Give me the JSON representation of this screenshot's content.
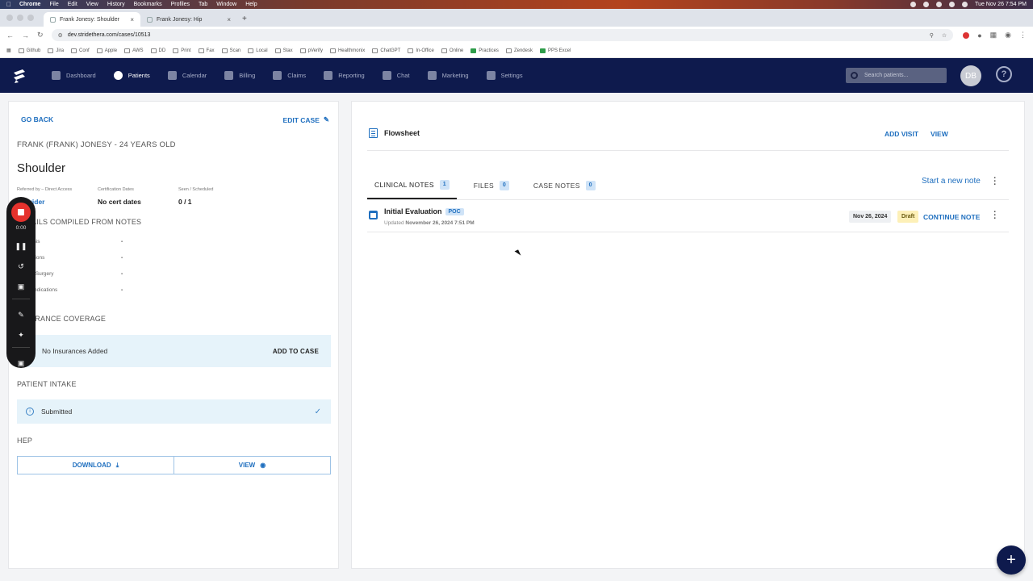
{
  "mac_menubar": {
    "app": "Chrome",
    "menus": [
      "File",
      "Edit",
      "View",
      "History",
      "Bookmarks",
      "Profiles",
      "Tab",
      "Window",
      "Help"
    ],
    "clock": "Tue Nov 26  7:54 PM"
  },
  "browser": {
    "tabs": [
      {
        "title": "Frank Jonesy: Shoulder",
        "active": true
      },
      {
        "title": "Frank Jonesy: Hip",
        "active": false
      }
    ],
    "url": "dev.stridethera.com/cases/10513",
    "bookmarks": [
      "Github",
      "Jira",
      "Conf",
      "Apple",
      "AWS",
      "DD",
      "Print",
      "Fax",
      "Scan",
      "Local",
      "Stax",
      "pVerify",
      "Healthmonix",
      "ChatGPT",
      "In-Office",
      "Online",
      "Practices",
      "Zendesk",
      "PPS Excel"
    ]
  },
  "appnav": {
    "items": [
      "Dashboard",
      "Patients",
      "Calendar",
      "Billing",
      "Claims",
      "Reporting",
      "Chat",
      "Marketing",
      "Settings"
    ],
    "active": "Patients",
    "search_placeholder": "Search patients...",
    "avatar_initials": "DB",
    "help_label": "?"
  },
  "left": {
    "go_back": "GO BACK",
    "edit_case": "EDIT CASE",
    "patient_line": "FRANK (FRANK) JONESY - 24 YEARS OLD",
    "case_title": "Shoulder",
    "meta": {
      "referred_label": "Referred by – Direct Access",
      "referred_value": "Provider",
      "cert_label": "Certification Dates",
      "cert_value": "No cert dates",
      "seen_label": "Seen / Scheduled",
      "seen_value": "0 / 1"
    },
    "details_heading": "DETAILS COMPILED FROM NOTES",
    "details": [
      {
        "label": "Diagnosis",
        "value": "-"
      },
      {
        "label": "Precautions",
        "value": "-"
      },
      {
        "label": "Date of Surgery",
        "value": "-"
      },
      {
        "label": "Contraindications",
        "value": "-"
      }
    ],
    "insurance_heading": "INSURANCE COVERAGE",
    "insurance_empty": "No Insurances Added",
    "add_to_case": "ADD TO CASE",
    "intake_heading": "PATIENT INTAKE",
    "intake_status": "Submitted",
    "hep_heading": "HEP",
    "download": "DOWNLOAD",
    "view": "VIEW"
  },
  "recorder": {
    "time": "0:00"
  },
  "right": {
    "flowsheet": "Flowsheet",
    "add_visit": "ADD VISIT",
    "view": "VIEW",
    "tabs": [
      {
        "label": "CLINICAL NOTES",
        "count": "1"
      },
      {
        "label": "FILES",
        "count": "0"
      },
      {
        "label": "CASE NOTES",
        "count": "0"
      }
    ],
    "start_new_note": "Start a new note",
    "note": {
      "title": "Initial Evaluation",
      "tag": "POC",
      "updated_prefix": "Updated",
      "updated_value": "November 26, 2024 7:51 PM",
      "date": "Nov 26, 2024",
      "status": "Draft",
      "action": "CONTINUE NOTE"
    }
  },
  "fab_label": "+"
}
